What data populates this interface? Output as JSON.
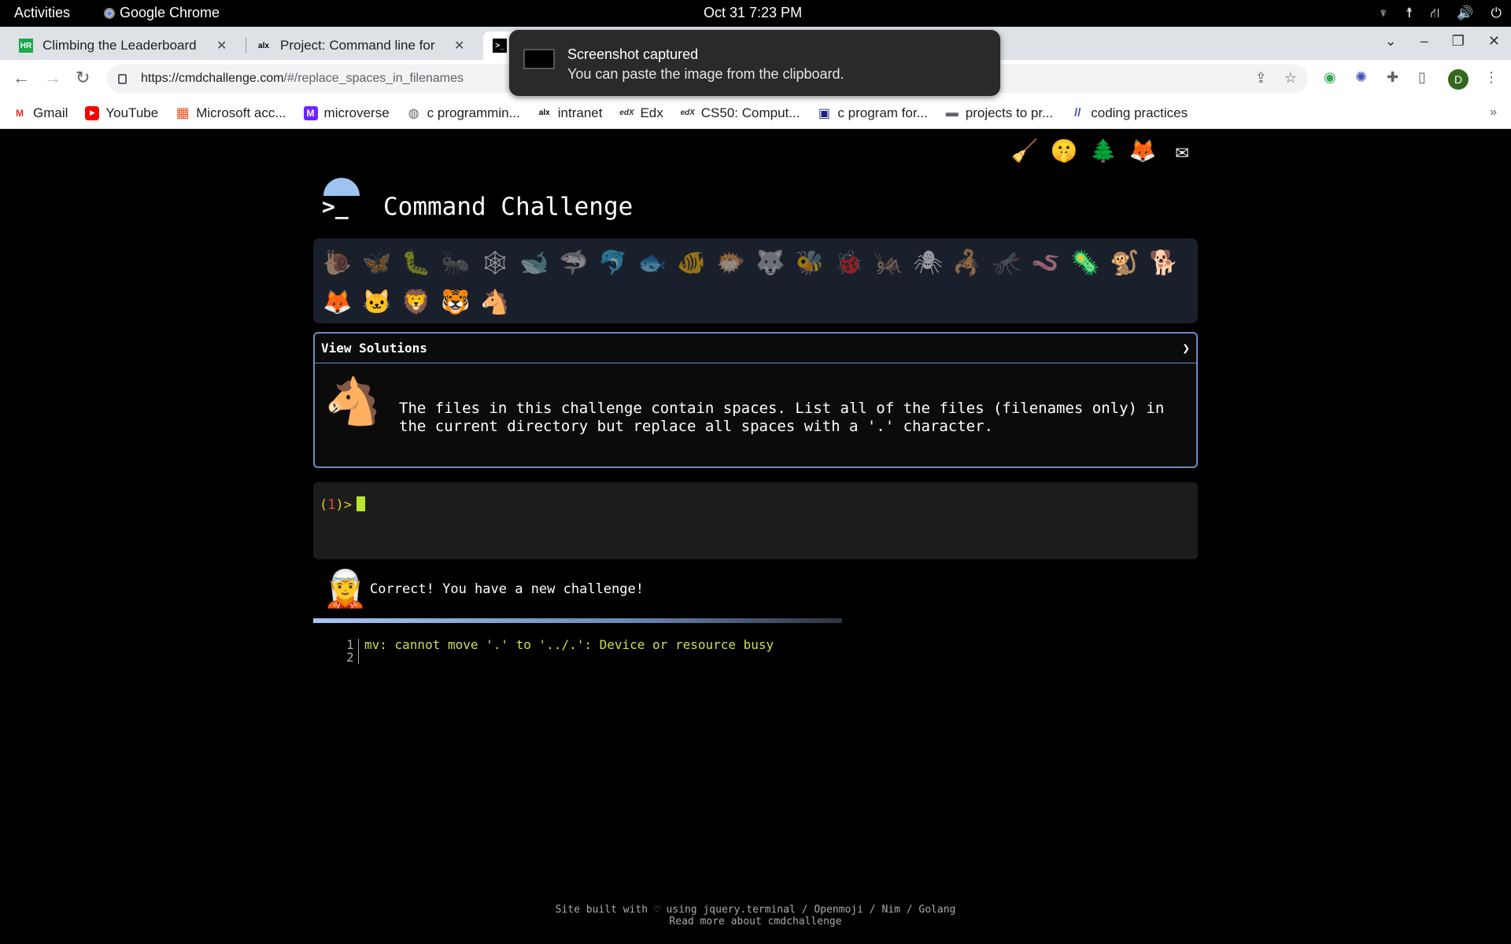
{
  "system_bar": {
    "activities": "Activities",
    "app_name": "Google Chrome",
    "clock": "Oct 31  7:23 PM"
  },
  "tabs": [
    {
      "title": "Climbing the Leaderboard",
      "favicon": "HR"
    },
    {
      "title": "Project: Command line for",
      "favicon": "alx"
    },
    {
      "title": "",
      "favicon": ">_"
    }
  ],
  "address_bar": {
    "url_host": "https://cmdchallenge.com",
    "url_path": "/#/replace_spaces_in_filenames",
    "profile_initial": "D"
  },
  "bookmarks": [
    {
      "label": "Gmail",
      "icon": "gmail-icon",
      "glyph": "M",
      "color": "#d93025"
    },
    {
      "label": "YouTube",
      "icon": "youtube-icon",
      "glyph": "▶",
      "color": "#ff0000"
    },
    {
      "label": "Microsoft acc...",
      "icon": "microsoft-icon",
      "glyph": "▦",
      "color": "#f25022"
    },
    {
      "label": "microverse",
      "icon": "microverse-icon",
      "glyph": "M",
      "color": "#6f23ff"
    },
    {
      "label": "c programmin...",
      "icon": "globe-icon",
      "glyph": "◍",
      "color": "#5f6368"
    },
    {
      "label": "intranet",
      "icon": "alx-icon",
      "glyph": "alx",
      "color": "#000000"
    },
    {
      "label": "Edx",
      "icon": "edx-icon",
      "glyph": "edX",
      "color": "#333333"
    },
    {
      "label": "CS50: Comput...",
      "icon": "edx-icon",
      "glyph": "edX",
      "color": "#333333"
    },
    {
      "label": "c program for...",
      "icon": "site-icon",
      "glyph": "▣",
      "color": "#1a237e"
    },
    {
      "label": "projects to pr...",
      "icon": "folder-icon",
      "glyph": "▬",
      "color": "#5f6368"
    },
    {
      "label": "coding practices",
      "icon": "codingpractices-icon",
      "glyph": "//",
      "color": "#3f51b5"
    }
  ],
  "notification": {
    "title": "Screenshot captured",
    "body": "You can paste the image from the clipboard."
  },
  "page": {
    "site_title": "Command Challenge",
    "top_icons": [
      "🧹",
      "🤫",
      "🌲",
      "🦊",
      "✉"
    ],
    "animals": [
      "🐌",
      "🦋",
      "🐛",
      "🐜",
      "🕸",
      "🐋",
      "🦈",
      "🐬",
      "🐟",
      "🐠",
      "🐡",
      "🐺",
      "🐝",
      "🐞",
      "🦗",
      "🕷",
      "🦂",
      "🦟",
      "🪱",
      "🦠",
      "🐒",
      "🐕",
      "🦊",
      "🐱",
      "🦁",
      "🐯",
      "🐴"
    ],
    "solutions_header": "View Solutions",
    "solutions_chevron": "❯",
    "challenge_icon": "🐴",
    "challenge_text": "The files in this challenge contain spaces. List all of the files (filenames only) in the current directory but replace all spaces with a '.' character.",
    "prompt_num": "1",
    "result_icon": "🧝",
    "result_message": "Correct! You have a new challenge!",
    "progress": 0.5,
    "output_lines": [
      {
        "num": "1",
        "text": "mv: cannot move '.' to '../.': Device or resource busy"
      },
      {
        "num": "2",
        "text": ""
      }
    ],
    "footer_line1": "Site built with ♡ using jquery.terminal / Openmoji / Nim / Golang",
    "footer_line2": "Read more about cmdchallenge"
  }
}
